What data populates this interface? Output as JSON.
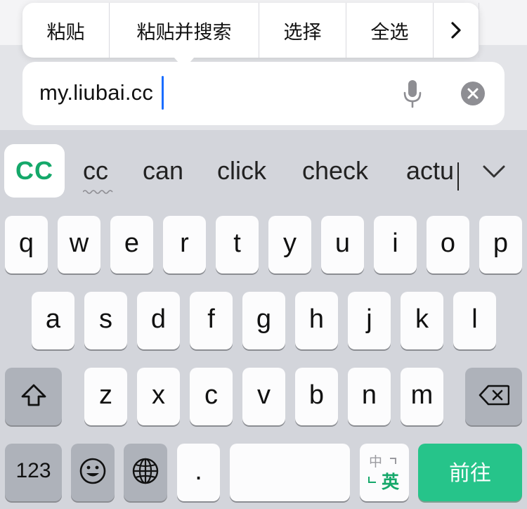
{
  "edit_menu": {
    "items": [
      "粘贴",
      "粘贴并搜索",
      "选择",
      "全选"
    ],
    "more_icon": "chevron-right-icon"
  },
  "url_field": {
    "value": "my.liubai.cc",
    "mic_icon": "microphone-icon",
    "clear_icon": "clear-circle-icon"
  },
  "suggestions": {
    "items": [
      "CC",
      "cc",
      "can",
      "click",
      "check",
      "actu"
    ],
    "expand_icon": "chevron-down-icon"
  },
  "keyboard": {
    "row1": [
      "q",
      "w",
      "e",
      "r",
      "t",
      "y",
      "u",
      "i",
      "o",
      "p"
    ],
    "row2": [
      "a",
      "s",
      "d",
      "f",
      "g",
      "h",
      "j",
      "k",
      "l"
    ],
    "row3": [
      "z",
      "x",
      "c",
      "v",
      "b",
      "n",
      "m"
    ],
    "numbers_label": "123",
    "period_label": ".",
    "space_label": "",
    "ime_toggle": {
      "top": "中",
      "bottom": "英"
    },
    "go_label": "前往",
    "colors": {
      "go": "#26c48a",
      "suggestion_accent": "#15a86a",
      "cursor": "#1a6dff"
    }
  }
}
